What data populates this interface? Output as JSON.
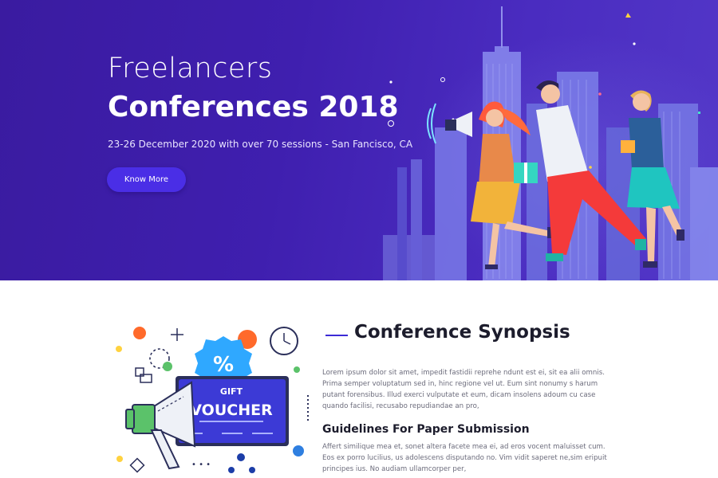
{
  "hero": {
    "title_line1": "Freelancers",
    "title_line2": "Conferences 2018",
    "subtitle": "23-26 December 2020 with over 70 sessions - San Fancisco, CA",
    "cta_label": "Know More",
    "illustration": "people-running-city-skyline-illustration"
  },
  "promo": {
    "illustration": "gift-voucher-megaphone-illustration",
    "voucher_line1": "GIFT",
    "voucher_line2": "VOUCHER",
    "badge_symbol": "%"
  },
  "synopsis": {
    "title": "Conference Synopsis",
    "body": "Lorem ipsum dolor sit amet, impedit fastidii reprehe ndunt est ei, sit ea alii omnis. Prima semper voluptatum sed in, hinc regione vel ut. Eum sint nonumy s harum putant forensibus. Illud exerci vulputate et eum, dicam insolens adoum cu case quando facilisi, recusabo repudiandae an pro,"
  },
  "guidelines": {
    "title": "Guidelines For Paper Submission",
    "body": "Affert similique mea et, sonet altera facete mea ei, ad eros vocent maluisset cum. Eos ex porro lucilius, us adolescens disputando no. Vim vidit saperet ne,sim eripuit principes ius. No audiam ullamcorper per,"
  },
  "colors": {
    "hero_bg": "#3f1faf",
    "accent": "#4a2ee6",
    "heading": "#1c1c2c",
    "body_text": "#6b6b7b"
  }
}
